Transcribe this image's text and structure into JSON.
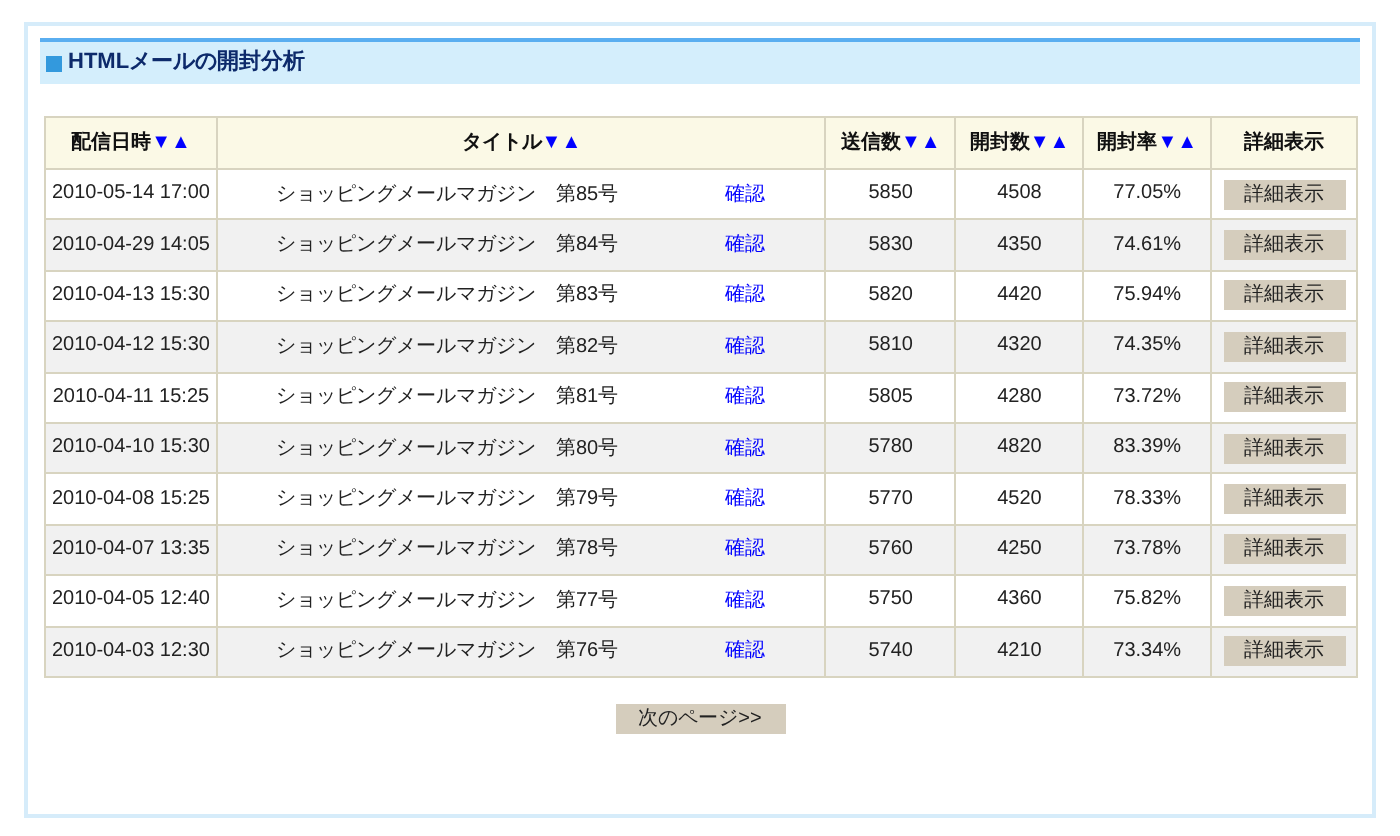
{
  "panel": {
    "title": "HTMLメールの開封分析"
  },
  "table": {
    "columns": [
      {
        "label": "配信日時",
        "sort_desc": "▼",
        "sort_asc": "▲"
      },
      {
        "label": "タイトル",
        "sort_desc": "▼",
        "sort_asc": "▲"
      },
      {
        "label": "送信数",
        "sort_desc": "▼",
        "sort_asc": "▲"
      },
      {
        "label": "開封数",
        "sort_desc": "▼",
        "sort_asc": "▲"
      },
      {
        "label": "開封率",
        "sort_desc": "▼",
        "sort_asc": "▲"
      },
      {
        "label": "詳細表示"
      }
    ],
    "rows": [
      {
        "date": "2010-05-14 17:00",
        "title": "ショッピングメールマガジン　第85号",
        "link": "確認",
        "sent": "5850",
        "opened": "4508",
        "rate": "77.05%",
        "action": "詳細表示"
      },
      {
        "date": "2010-04-29 14:05",
        "title": "ショッピングメールマガジン　第84号",
        "link": "確認",
        "sent": "5830",
        "opened": "4350",
        "rate": "74.61%",
        "action": "詳細表示"
      },
      {
        "date": "2010-04-13 15:30",
        "title": "ショッピングメールマガジン　第83号",
        "link": "確認",
        "sent": "5820",
        "opened": "4420",
        "rate": "75.94%",
        "action": "詳細表示"
      },
      {
        "date": "2010-04-12 15:30",
        "title": "ショッピングメールマガジン　第82号",
        "link": "確認",
        "sent": "5810",
        "opened": "4320",
        "rate": "74.35%",
        "action": "詳細表示"
      },
      {
        "date": "2010-04-11 15:25",
        "title": "ショッピングメールマガジン　第81号",
        "link": "確認",
        "sent": "5805",
        "opened": "4280",
        "rate": "73.72%",
        "action": "詳細表示"
      },
      {
        "date": "2010-04-10 15:30",
        "title": "ショッピングメールマガジン　第80号",
        "link": "確認",
        "sent": "5780",
        "opened": "4820",
        "rate": "83.39%",
        "action": "詳細表示"
      },
      {
        "date": "2010-04-08 15:25",
        "title": "ショッピングメールマガジン　第79号",
        "link": "確認",
        "sent": "5770",
        "opened": "4520",
        "rate": "78.33%",
        "action": "詳細表示"
      },
      {
        "date": "2010-04-07 13:35",
        "title": "ショッピングメールマガジン　第78号",
        "link": "確認",
        "sent": "5760",
        "opened": "4250",
        "rate": "73.78%",
        "action": "詳細表示"
      },
      {
        "date": "2010-04-05 12:40",
        "title": "ショッピングメールマガジン　第77号",
        "link": "確認",
        "sent": "5750",
        "opened": "4360",
        "rate": "75.82%",
        "action": "詳細表示"
      },
      {
        "date": "2010-04-03 12:30",
        "title": "ショッピングメールマガジン　第76号",
        "link": "確認",
        "sent": "5740",
        "opened": "4210",
        "rate": "73.34%",
        "action": "詳細表示"
      }
    ]
  },
  "next_page": "次のページ>>"
}
